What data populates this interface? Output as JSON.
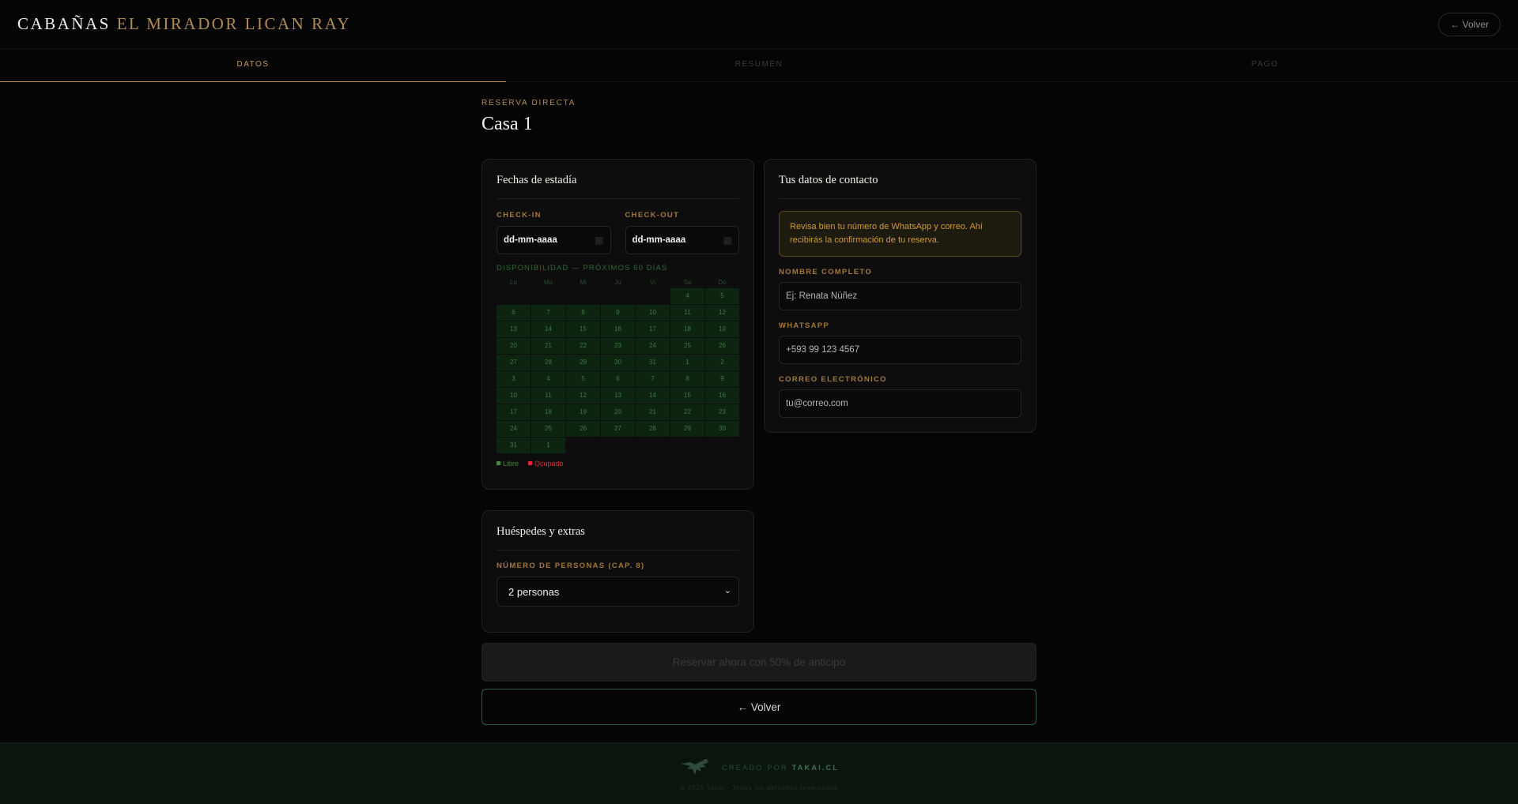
{
  "header": {
    "brand_part1": "CABAÑAS",
    "brand_part2": "EL MIRADOR LICAN RAY",
    "back_label": "← Volver"
  },
  "steps": [
    {
      "label": "DATOS",
      "active": true
    },
    {
      "label": "RESUMEN",
      "active": false
    },
    {
      "label": "PAGO",
      "active": false
    }
  ],
  "main": {
    "eyebrow": "RESERVA DIRECTA",
    "title": "Casa 1"
  },
  "stay_card": {
    "title": "Fechas de estadía",
    "checkin_label": "CHECK-IN",
    "checkin_value": "dd-mm-aaaa",
    "checkout_label": "CHECK-OUT",
    "checkout_value": "dd-mm-aaaa",
    "availability_label": "DISPONIBILIDAD — PRÓXIMOS 60 DÍAS",
    "weekdays": [
      "Lu",
      "Ma",
      "Mi",
      "Ju",
      "Vi",
      "Sa",
      "Do"
    ],
    "leading_blanks": 5,
    "days": [
      "4",
      "5",
      "6",
      "7",
      "8",
      "9",
      "10",
      "11",
      "12",
      "13",
      "14",
      "15",
      "16",
      "17",
      "18",
      "19",
      "20",
      "21",
      "22",
      "23",
      "24",
      "25",
      "26",
      "27",
      "28",
      "29",
      "30",
      "31",
      "1",
      "2",
      "3",
      "4",
      "5",
      "6",
      "7",
      "8",
      "9",
      "10",
      "11",
      "12",
      "13",
      "14",
      "15",
      "16",
      "17",
      "18",
      "19",
      "20",
      "21",
      "22",
      "23",
      "24",
      "25",
      "26",
      "27",
      "28",
      "29",
      "30",
      "31",
      "1"
    ],
    "legend_free": "Libre",
    "legend_busy": "Ocupado"
  },
  "contact_card": {
    "title": "Tus datos de contacto",
    "notice": "Revisa bien tu número de WhatsApp y correo. Ahí recibirás la confirmación de tu reserva.",
    "name_label": "NOMBRE COMPLETO",
    "name_placeholder": "Ej: Renata Núñez",
    "whatsapp_label": "WHATSAPP",
    "whatsapp_placeholder": "+593 99 123 4567",
    "email_label": "CORREO ELECTRÓNICO",
    "email_placeholder": "tu@correo.com"
  },
  "guests_card": {
    "title": "Huéspedes y extras",
    "people_label": "NÚMERO DE PERSONAS (CAP. 8)",
    "people_selected": "2 personas"
  },
  "actions": {
    "reserve_label": "Reservar ahora con 50% de anticipo",
    "back_label": "← Volver"
  },
  "footer": {
    "credit_prefix": "CREADO POR",
    "credit_brand": "TAKAI.CL",
    "copyright": "© 2025 Takai · Todos los derechos reservados"
  },
  "colors": {
    "accent": "#c89a55",
    "free": "#3f8a43",
    "busy": "#e0283a"
  }
}
